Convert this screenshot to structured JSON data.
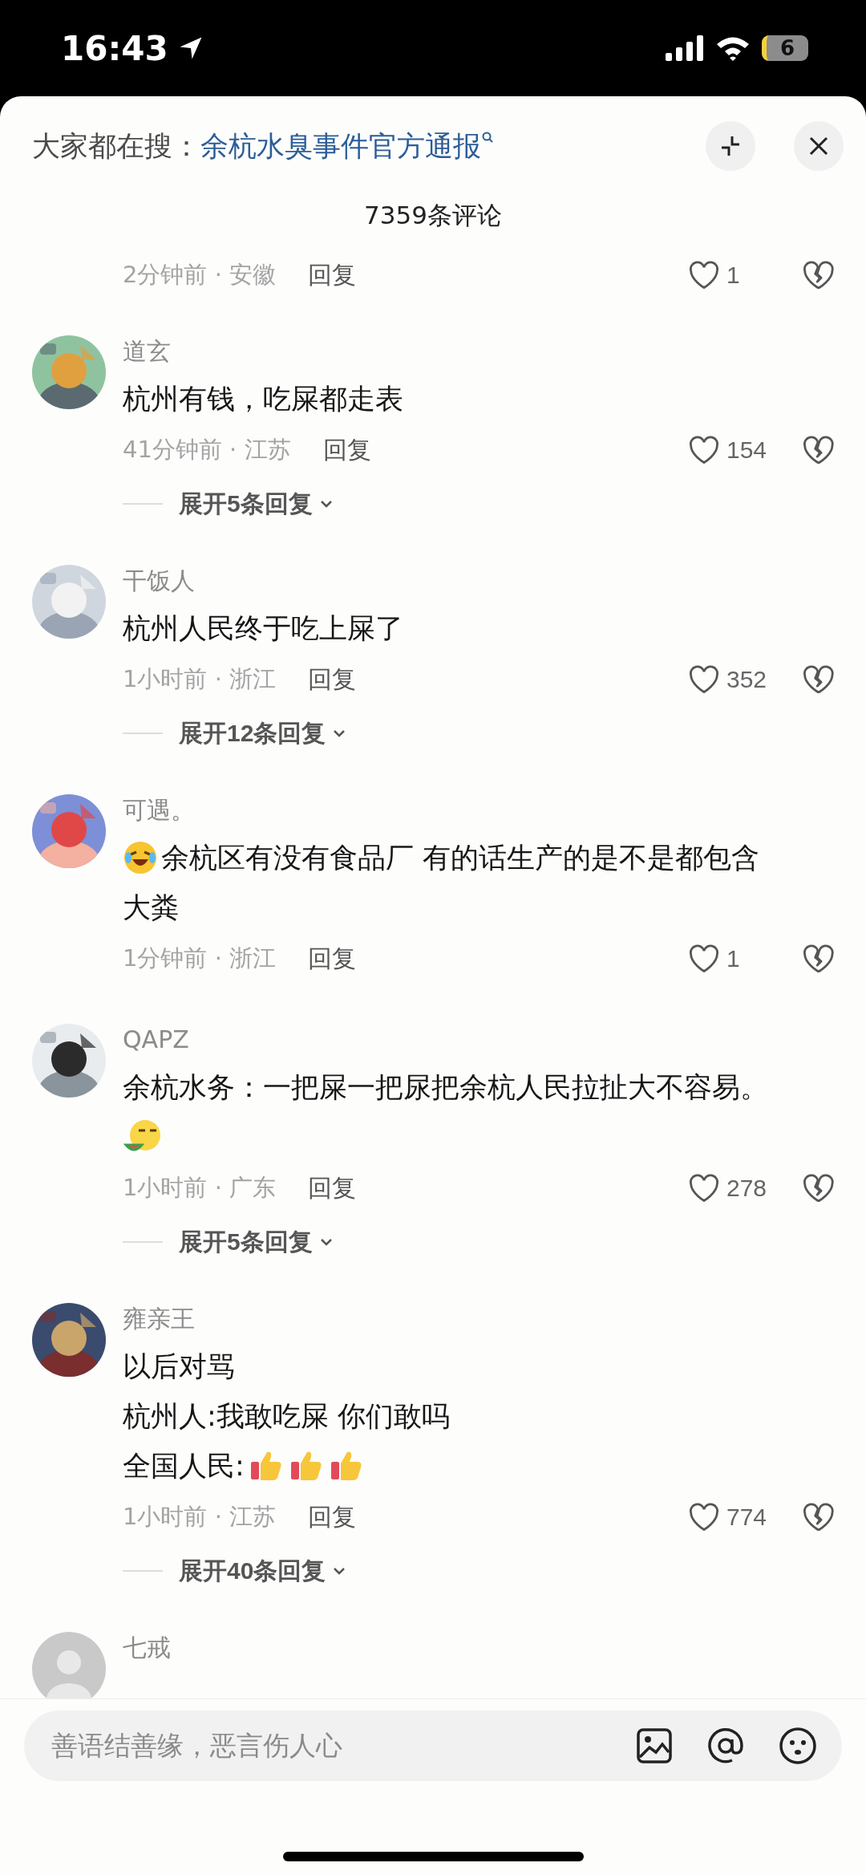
{
  "status_bar": {
    "time": "16:43",
    "battery": "6"
  },
  "header": {
    "prefix": "大家都在搜：",
    "search_link": "余杭水臭事件官方通报"
  },
  "comment_count": "7359条评论",
  "comments": [
    {
      "time_place": "2分钟前 · 安徽",
      "reply": "回复",
      "likes": "1"
    },
    {
      "name": "道玄",
      "avatar": {
        "kind": "picture"
      },
      "lines": [
        [
          {
            "kind": "text",
            "text": "杭州有钱，吃屎都走表"
          }
        ]
      ],
      "time_place": "41分钟前 · 江苏",
      "reply": "回复",
      "likes": "154",
      "expand": "展开5条回复"
    },
    {
      "name": "干饭人",
      "avatar": {
        "kind": "picture"
      },
      "lines": [
        [
          {
            "kind": "text",
            "text": "杭州人民终于吃上屎了"
          }
        ]
      ],
      "time_place": "1小时前 · 浙江",
      "reply": "回复",
      "likes": "352",
      "expand": "展开12条回复"
    },
    {
      "name": "可遇。",
      "avatar": {
        "kind": "picture"
      },
      "lines": [
        [
          {
            "kind": "laugh"
          },
          {
            "kind": "text",
            "text": "余杭区有没有食品厂 有的话生产的是不是都包含"
          }
        ],
        [
          {
            "kind": "text",
            "text": "大粪"
          }
        ]
      ],
      "time_place": "1分钟前 · 浙江",
      "reply": "回复",
      "likes": "1"
    },
    {
      "name": "QAPZ",
      "avatar": {
        "kind": "picture"
      },
      "lines": [
        [
          {
            "kind": "text",
            "text": "余杭水务：一把屎一把尿把余杭人民拉扯大不容易。"
          }
        ],
        [
          {
            "kind": "sticker"
          }
        ]
      ],
      "time_place": "1小时前 · 广东",
      "reply": "回复",
      "likes": "278",
      "expand": "展开5条回复"
    },
    {
      "name": "雍亲王",
      "avatar": {
        "kind": "picture"
      },
      "lines": [
        [
          {
            "kind": "text",
            "text": "以后对骂"
          }
        ],
        [
          {
            "kind": "text",
            "text": "杭州人:我敢吃屎 你们敢吗"
          }
        ],
        [
          {
            "kind": "text",
            "text": "全国人民:"
          },
          {
            "kind": "thumb"
          },
          {
            "kind": "thumb"
          },
          {
            "kind": "thumb"
          }
        ]
      ],
      "time_place": "1小时前 · 江苏",
      "reply": "回复",
      "likes": "774",
      "expand": "展开40条回复"
    },
    {
      "name": "七戒",
      "avatar": {
        "kind": "default"
      }
    }
  ],
  "input": {
    "placeholder": "善语结善缘，恶言伤人心"
  }
}
